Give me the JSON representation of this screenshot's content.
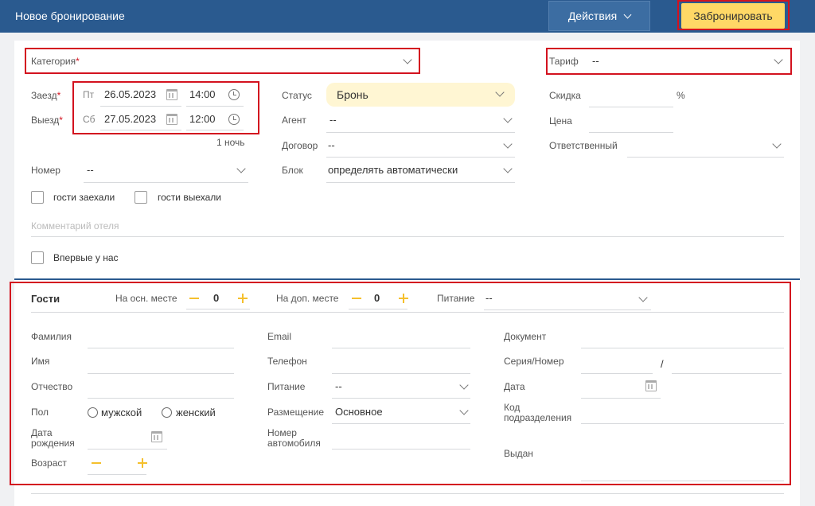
{
  "header": {
    "title": "Новое бронирование",
    "actions_label": "Действия",
    "book_label": "Забронировать"
  },
  "booking": {
    "category_label": "Категория",
    "tariff_label": "Тариф",
    "tariff_value": "--",
    "checkin_label": "Заезд",
    "checkin_day": "Пт",
    "checkin_date": "26.05.2023",
    "checkin_time": "14:00",
    "checkout_label": "Выезд",
    "checkout_day": "Сб",
    "checkout_date": "27.05.2023",
    "checkout_time": "12:00",
    "nights": "1 ночь",
    "room_label": "Номер",
    "room_value": "--",
    "guests_in_label": "гости заехали",
    "guests_out_label": "гости выехали",
    "comment_placeholder": "Комментарий отеля",
    "first_time_label": "Впервые у нас",
    "status_label": "Статус",
    "status_value": "Бронь",
    "agent_label": "Агент",
    "agent_value": "--",
    "contract_label": "Договор",
    "contract_value": "--",
    "block_label": "Блок",
    "block_value": "определять автоматически",
    "discount_label": "Скидка",
    "discount_unit": "%",
    "price_label": "Цена",
    "responsible_label": "Ответственный"
  },
  "guests": {
    "title": "Гости",
    "main_place_label": "На осн. месте",
    "main_place_count": "0",
    "extra_place_label": "На доп. месте",
    "extra_place_count": "0",
    "meal_label": "Питание",
    "meal_value": "--",
    "lastname_label": "Фамилия",
    "firstname_label": "Имя",
    "patronymic_label": "Отчество",
    "gender_label": "Пол",
    "gender_male": "мужской",
    "gender_female": "женский",
    "birthdate_label_1": "Дата",
    "birthdate_label_2": "рождения",
    "age_label": "Возраст",
    "email_label": "Email",
    "phone_label": "Телефон",
    "guest_meal_label": "Питание",
    "guest_meal_value": "--",
    "placement_label": "Размещение",
    "placement_value": "Основное",
    "car_label_1": "Номер",
    "car_label_2": "автомобиля",
    "document_label": "Документ",
    "series_label": "Серия/Номер",
    "series_sep": "/",
    "doc_date_label": "Дата",
    "dept_code_label_1": "Код",
    "dept_code_label_2": "подразделения",
    "issued_label": "Выдан"
  }
}
